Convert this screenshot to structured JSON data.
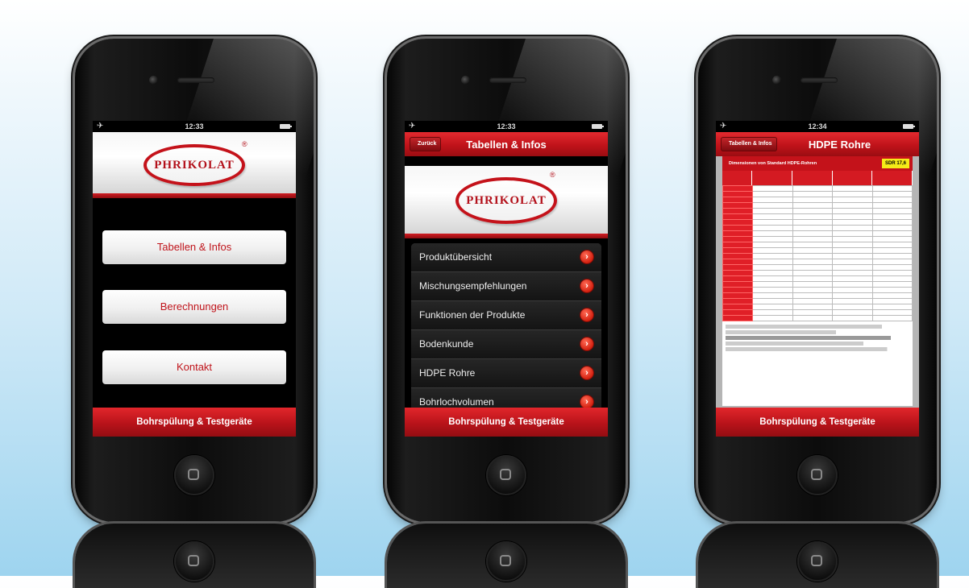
{
  "phones": [
    {
      "status": {
        "time": "12:33"
      },
      "logo": {
        "text": "PHRIKOLAT",
        "registered": "®"
      },
      "menu": [
        "Tabellen & Infos",
        "Berechnungen",
        "Kontakt"
      ],
      "footer": "Bohrspülung & Testgeräte"
    },
    {
      "status": {
        "time": "12:33"
      },
      "nav": {
        "back_label": "Zurück",
        "title": "Tabellen & Infos"
      },
      "logo": {
        "text": "PHRIKOLAT",
        "registered": "®"
      },
      "list": [
        "Produktübersicht",
        "Mischungsempfehlungen",
        "Funktionen der Produkte",
        "Bodenkunde",
        "HDPE Rohre",
        "Bohrlochvolumen"
      ],
      "footer": "Bohrspülung & Testgeräte"
    },
    {
      "status": {
        "time": "12:34"
      },
      "nav": {
        "back_label": "Tabellen & Infos",
        "title": "HDPE Rohre"
      },
      "table": {
        "heading": "Dimensionen von Standard HDPE-Rohren",
        "sdr_label": "SDR 17,6"
      },
      "footer": "Bohrspülung & Testgeräte"
    }
  ],
  "icons": {
    "airplane": "✈",
    "list_arrow": "›"
  }
}
